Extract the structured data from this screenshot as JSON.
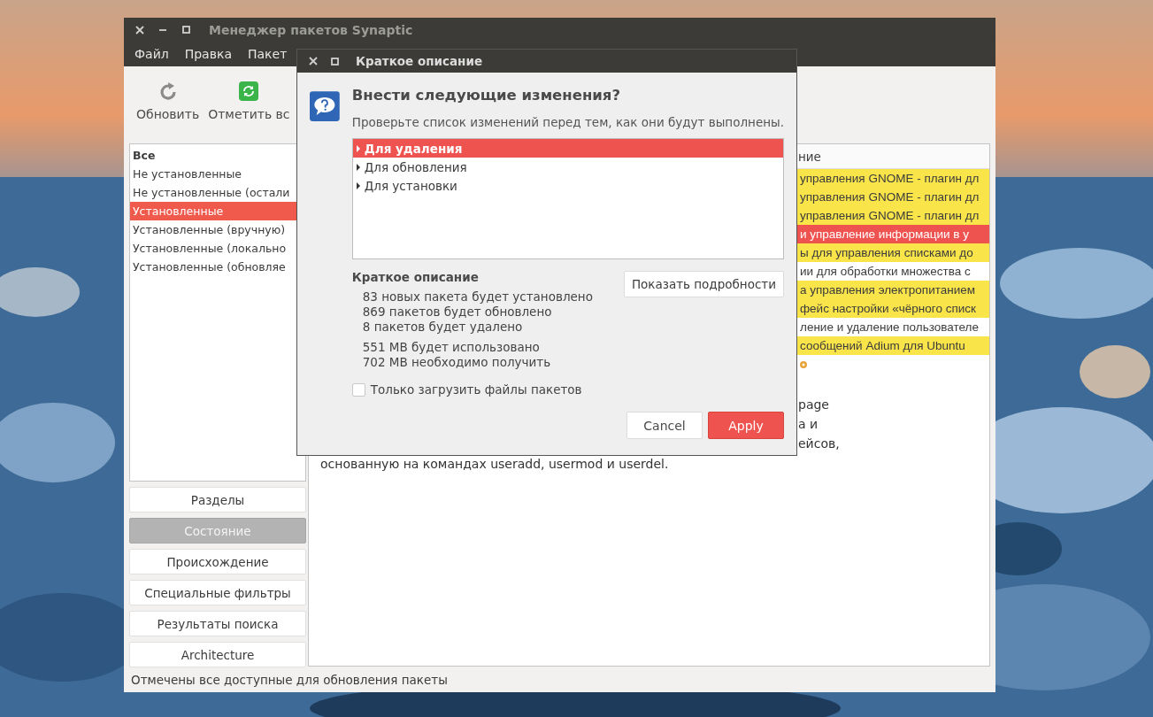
{
  "main_window": {
    "title": "Менеджер пакетов Synaptic",
    "menu": [
      "Файл",
      "Правка",
      "Пакет"
    ],
    "toolbar": [
      {
        "kind": "reload",
        "label": "Обновить"
      },
      {
        "kind": "mark",
        "label": "Отметить вс"
      }
    ],
    "filters": [
      {
        "label": "Все",
        "heading": true,
        "selected": false
      },
      {
        "label": "Не установленные",
        "heading": false,
        "selected": false
      },
      {
        "label": "Не установленные (остали",
        "heading": false,
        "selected": false
      },
      {
        "label": "Установленные",
        "heading": false,
        "selected": true
      },
      {
        "label": "Установленные (вручную)",
        "heading": false,
        "selected": false
      },
      {
        "label": "Установленные (локально",
        "heading": false,
        "selected": false
      },
      {
        "label": "Установленные (обновляе",
        "heading": false,
        "selected": false
      }
    ],
    "filter_groups": [
      {
        "label": "Разделы",
        "selected": false
      },
      {
        "label": "Состояние",
        "selected": true
      },
      {
        "label": "Происхождение",
        "selected": false
      },
      {
        "label": "Специальные фильтры",
        "selected": false
      },
      {
        "label": "Результаты поиска",
        "selected": false
      },
      {
        "label": "Architecture",
        "selected": false
      }
    ],
    "package_table": {
      "column_header": "ние",
      "rows": [
        {
          "text": "управления GNOME - плагин дл",
          "kind": "upgradable",
          "selected": false
        },
        {
          "text": "управления GNOME - плагин дл",
          "kind": "upgradable",
          "selected": false
        },
        {
          "text": "управления GNOME - плагин дл",
          "kind": "upgradable",
          "selected": false
        },
        {
          "text": "и управление информации в у",
          "selected": true
        },
        {
          "text": "ы для управления списками до",
          "kind": "upgradable",
          "selected": false
        },
        {
          "text": "ии для обработки множества с",
          "kind": "installed",
          "selected": false
        },
        {
          "text": "а управления электропитанием",
          "kind": "upgradable",
          "selected": false
        },
        {
          "text": "фейс настройки «чёрного списк",
          "kind": "upgradable",
          "selected": false
        },
        {
          "text": "ление и удаление пользователе",
          "kind": "installed",
          "selected": false
        },
        {
          "text": "сообщений Adium для Ubuntu",
          "kind": "upgradable",
          "selected": false
        }
      ]
    },
    "description": {
      "fragments": [
        "page",
        "а и",
        "ейсов,"
      ],
      "line": "основанную на командах useradd, usermod и userdel."
    },
    "status_bar": "Отмечены все доступные для обновления пакеты"
  },
  "dialog": {
    "title": "Краткое описание",
    "heading": "Внести следующие изменения?",
    "subheading": "Проверьте список изменений перед тем, как они будут выполнены.",
    "changes": [
      {
        "label": "Для удаления",
        "selected": true,
        "expanded": false
      },
      {
        "label": "Для обновления",
        "selected": false,
        "expanded": false
      },
      {
        "label": "Для установки",
        "selected": false,
        "expanded": false
      }
    ],
    "summary_title": "Краткое описание",
    "summary_groups": [
      [
        "83 новых пакета будет установлено",
        "869 пакетов будет обновлено",
        "8 пакетов будет удалено"
      ],
      [
        "551 MB будет использовано",
        "702 MB необходимо получить"
      ]
    ],
    "details_button": "Показать подробности",
    "download_only": {
      "label": "Только загрузить файлы пакетов",
      "checked": false
    },
    "buttons": [
      {
        "kind": "secondary",
        "label": "Cancel"
      },
      {
        "kind": "primary",
        "label": "Apply"
      }
    ]
  }
}
